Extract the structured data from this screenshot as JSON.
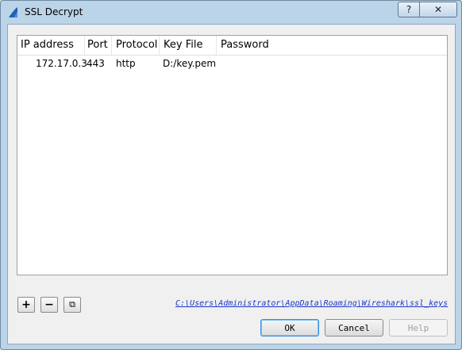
{
  "window": {
    "title": "SSL Decrypt",
    "help_glyph": "?",
    "close_glyph": "✕"
  },
  "table": {
    "columns": [
      "IP address",
      "Port",
      "Protocol",
      "Key File",
      "Password"
    ],
    "rows": [
      {
        "ip": "172.17.0.3",
        "port": "443",
        "protocol": "http",
        "key_file": "D:/key.pem",
        "password": ""
      }
    ]
  },
  "toolbar": {
    "add_glyph": "+",
    "remove_glyph": "−",
    "copy_glyph": "⧉",
    "path": "C:\\Users\\Administrator\\AppData\\Roaming\\Wireshark\\ssl_keys"
  },
  "buttons": {
    "ok": "OK",
    "cancel": "Cancel",
    "help": "Help"
  },
  "colors": {
    "accent": "#3a8ee0",
    "link": "#1a36c8"
  }
}
